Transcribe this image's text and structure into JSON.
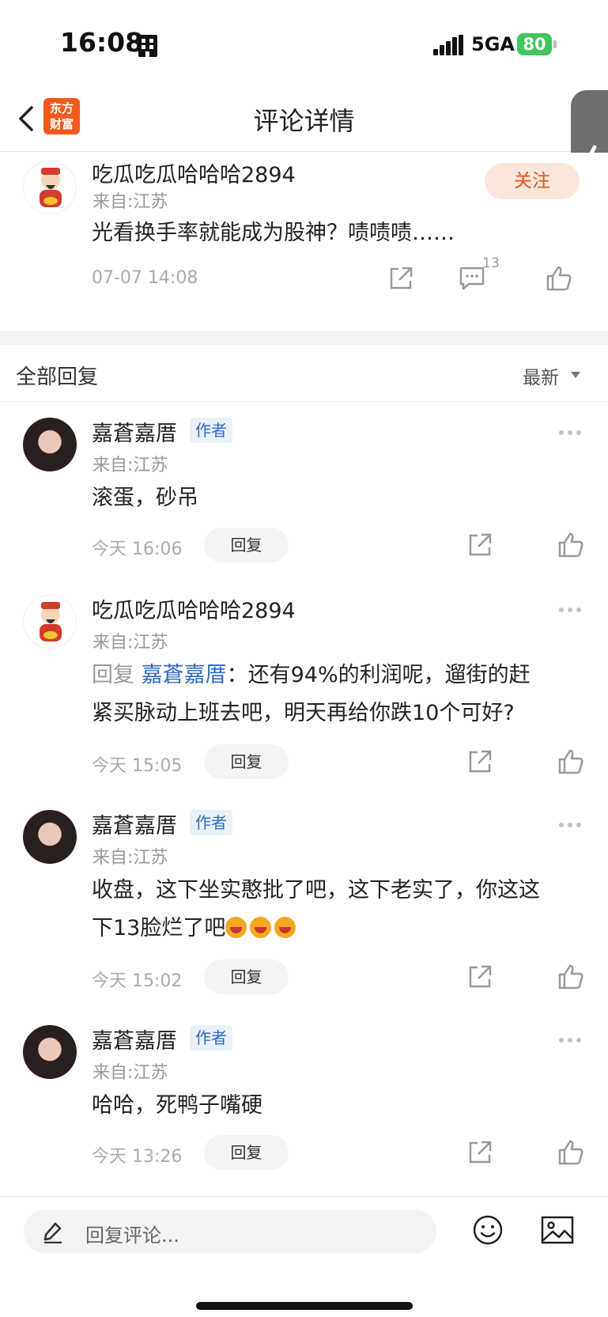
{
  "status_bar": {
    "time": "16:08",
    "network": "5GA",
    "battery": "80"
  },
  "nav": {
    "title": "评论详情",
    "logo_line1": "东方",
    "logo_line2": "财富"
  },
  "main_comment": {
    "username": "吃瓜吃瓜哈哈哈2894",
    "location": "来自:江苏",
    "content": "光看换手率就能成为股神？啧啧啧……",
    "timestamp": "07-07 14:08",
    "follow_label": "关注",
    "reply_count": "13"
  },
  "section": {
    "title": "全部回复",
    "sort": "最新"
  },
  "replies": [
    {
      "username": "嘉蒼嘉厝",
      "tag": "作者",
      "location": "来自:江苏",
      "content": "滚蛋，砂吊",
      "timestamp": "今天 16:06",
      "reply_label": "回复"
    },
    {
      "username": "吃瓜吃瓜哈哈哈2894",
      "location": "来自:江苏",
      "reply_prefix": "回复",
      "reply_target": "嘉蒼嘉厝",
      "content_line1": "：还有94%的利润呢，遛街的赶",
      "content_line2": "紧买脉动上班去吧，明天再给你跌10个可好?",
      "timestamp": "今天 15:05",
      "reply_label": "回复"
    },
    {
      "username": "嘉蒼嘉厝",
      "tag": "作者",
      "location": "来自:江苏",
      "content_line1": "收盘，这下坐实憨批了吧，这下老实了，你这这",
      "content_line2": "下13脸烂了吧",
      "timestamp": "今天 15:02",
      "reply_label": "回复"
    },
    {
      "username": "嘉蒼嘉厝",
      "tag": "作者",
      "location": "来自:江苏",
      "content": "哈哈，死鸭子嘴硬",
      "timestamp": "今天 13:26",
      "reply_label": "回复"
    }
  ],
  "bottom_bar": {
    "placeholder": "回复评论..."
  }
}
